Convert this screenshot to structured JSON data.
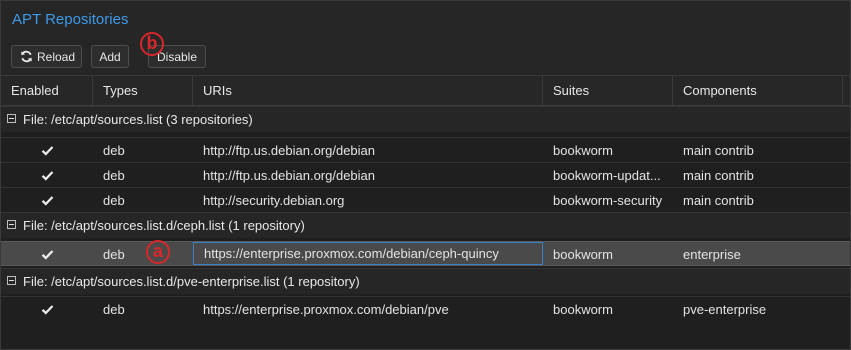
{
  "panel": {
    "title": "APT Repositories"
  },
  "toolbar": {
    "reload_label": "Reload",
    "add_label": "Add",
    "disable_label": "Disable"
  },
  "markers": {
    "a": "a",
    "b": "b"
  },
  "table": {
    "columns": [
      "Enabled",
      "Types",
      "URIs",
      "Suites",
      "Components"
    ],
    "groups": [
      {
        "label": "File: /etc/apt/sources.list (3 repositories)",
        "rows": [
          {
            "enabled": true,
            "type": "deb",
            "uri": "http://ftp.us.debian.org/debian",
            "suite": "bookworm",
            "components": "main contrib"
          },
          {
            "enabled": true,
            "type": "deb",
            "uri": "http://ftp.us.debian.org/debian",
            "suite": "bookworm-updat...",
            "components": "main contrib"
          },
          {
            "enabled": true,
            "type": "deb",
            "uri": "http://security.debian.org",
            "suite": "bookworm-security",
            "components": "main contrib"
          }
        ]
      },
      {
        "label": "File: /etc/apt/sources.list.d/ceph.list (1 repository)",
        "rows": [
          {
            "enabled": true,
            "type": "deb",
            "uri": "https://enterprise.proxmox.com/debian/ceph-quincy",
            "suite": "bookworm",
            "components": "enterprise",
            "selected": true
          }
        ]
      },
      {
        "label": "File: /etc/apt/sources.list.d/pve-enterprise.list (1 repository)",
        "rows": [
          {
            "enabled": true,
            "type": "deb",
            "uri": "https://enterprise.proxmox.com/debian/pve",
            "suite": "bookworm",
            "components": "pve-enterprise"
          }
        ]
      }
    ]
  },
  "icons": {
    "reload": "reload-icon",
    "check": "checkmark-icon",
    "collapse": "collapse-minus-icon"
  },
  "colors": {
    "title": "#3c9ae8",
    "marker": "#d9262a",
    "selected_row": "#4a4a4a",
    "focus_border": "#3c7fc4"
  }
}
